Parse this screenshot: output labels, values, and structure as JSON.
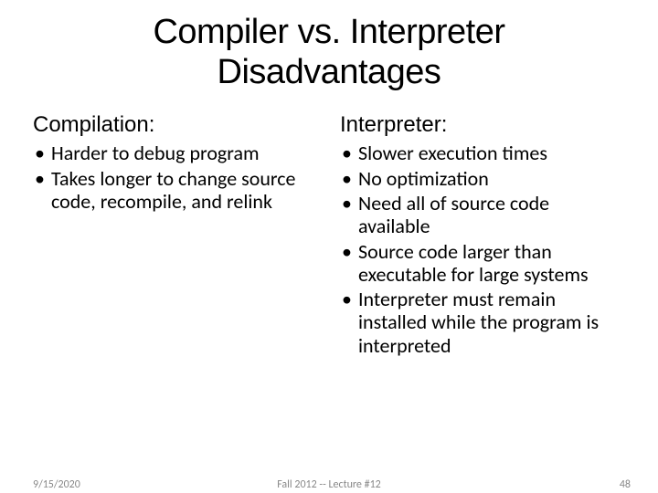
{
  "title_line1": "Compiler vs. Interpreter",
  "title_line2": "Disadvantages",
  "left": {
    "heading": "Compilation:",
    "items": [
      "Harder to debug program",
      "Takes longer to change source code, recompile, and relink"
    ]
  },
  "right": {
    "heading": "Interpreter:",
    "items": [
      "Slower execution times",
      "No optimization",
      "Need all of source code available",
      "Source code larger than executable for large systems",
      "Interpreter must remain installed while the program is interpreted"
    ]
  },
  "footer": {
    "date": "9/15/2020",
    "center": "Fall 2012 -- Lecture #12",
    "page": "48"
  }
}
